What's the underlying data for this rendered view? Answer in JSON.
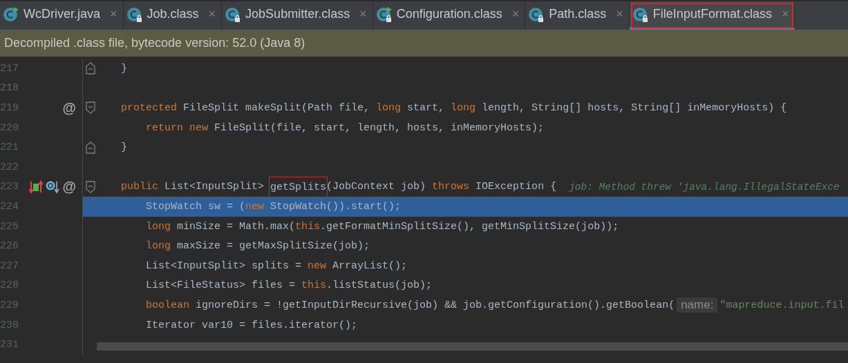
{
  "tabs": [
    {
      "label": "WcDriver.java",
      "kind": "runnable",
      "selected": false,
      "highlighted": false,
      "close": "×"
    },
    {
      "label": "Job.class",
      "kind": "locked",
      "selected": false,
      "highlighted": false,
      "close": "×"
    },
    {
      "label": "JobSubmitter.class",
      "kind": "locked",
      "selected": false,
      "highlighted": false,
      "close": "×"
    },
    {
      "label": "Configuration.class",
      "kind": "runnable-locked",
      "selected": false,
      "highlighted": false,
      "close": "×"
    },
    {
      "label": "Path.class",
      "kind": "locked",
      "selected": false,
      "highlighted": false,
      "close": "×"
    },
    {
      "label": "FileInputFormat.class",
      "kind": "locked",
      "selected": true,
      "highlighted": true,
      "close": "×"
    }
  ],
  "banner": "Decompiled .class file, bytecode version: 52.0 (Java 8)",
  "lines": [
    {
      "number": "217",
      "kind": "fold-end",
      "selected": false,
      "segments": [
        {
          "kind": "text",
          "text": "}"
        }
      ]
    },
    {
      "number": "218",
      "selected": false
    },
    {
      "number": "219",
      "kind": "fold-start",
      "selected": false,
      "marks": [
        {
          "kind": "text",
          "text": "@"
        }
      ],
      "segments": [
        {
          "kind": "keyword",
          "text": "protected"
        },
        {
          "kind": "text",
          "text": " FileSplit makeSplit(Path file, "
        },
        {
          "kind": "keyword",
          "text": "long"
        },
        {
          "kind": "text",
          "text": " start, "
        },
        {
          "kind": "keyword",
          "text": "long"
        },
        {
          "kind": "text",
          "text": " length, String[] hosts, String[] inMemoryHosts) {"
        }
      ],
      "children": [
        {
          "number": "220",
          "selected": false,
          "segments": [
            {
              "kind": "keyword",
              "text": "return new"
            },
            {
              "kind": "text",
              "text": " FileSplit(file, start, length, hosts, inMemoryHosts);"
            }
          ]
        }
      ]
    },
    {
      "number": "221",
      "kind": "fold-end",
      "selected": false,
      "segments": [
        {
          "kind": "text",
          "text": "}"
        }
      ]
    },
    {
      "number": "222",
      "selected": false
    },
    {
      "number": "223",
      "kind": "fold-start",
      "selected": false,
      "marks": [
        {
          "kind": "overriding"
        },
        {
          "kind": "overridden"
        },
        {
          "kind": "text",
          "text": "@"
        }
      ],
      "segments": [
        {
          "kind": "keyword",
          "text": "public"
        },
        {
          "kind": "text",
          "text": " List<InputSplit> "
        },
        {
          "kind": "highlighted",
          "text": "getSplits"
        },
        {
          "kind": "text",
          "text": "(JobContext job) "
        },
        {
          "kind": "keyword",
          "text": "throws"
        },
        {
          "kind": "text",
          "text": " IOException {"
        },
        {
          "kind": "hint",
          "text": "job: Method threw 'java.lang.IllegalStateExce"
        }
      ],
      "children": [
        {
          "number": "224",
          "selected": true,
          "segments": [
            {
              "kind": "text",
              "text": "StopWatch sw = ("
            },
            {
              "kind": "keyword",
              "text": "new"
            },
            {
              "kind": "text",
              "text": " StopWatch()).start();"
            }
          ]
        },
        {
          "number": "225",
          "selected": false,
          "segments": [
            {
              "kind": "keyword",
              "text": "long"
            },
            {
              "kind": "text",
              "text": " minSize = Math.max("
            },
            {
              "kind": "keyword",
              "text": "this"
            },
            {
              "kind": "text",
              "text": ".getFormatMinSplitSize(), getMinSplitSize(job));"
            }
          ]
        },
        {
          "number": "226",
          "selected": false,
          "segments": [
            {
              "kind": "keyword",
              "text": "long"
            },
            {
              "kind": "text",
              "text": " maxSize = getMaxSplitSize(job);"
            }
          ]
        },
        {
          "number": "227",
          "selected": false,
          "segments": [
            {
              "kind": "text",
              "text": "List<InputSplit> splits = "
            },
            {
              "kind": "keyword",
              "text": "new"
            },
            {
              "kind": "text",
              "text": " ArrayList();"
            }
          ]
        },
        {
          "number": "228",
          "selected": false,
          "segments": [
            {
              "kind": "text",
              "text": "List<FileStatus> files = "
            },
            {
              "kind": "keyword",
              "text": "this"
            },
            {
              "kind": "text",
              "text": ".listStatus(job);"
            }
          ]
        },
        {
          "number": "229",
          "selected": false,
          "segments": [
            {
              "kind": "keyword",
              "text": "boolean"
            },
            {
              "kind": "text",
              "text": " ignoreDirs = !getInputDirRecursive(job) && job.getConfiguration().getBoolean("
            },
            {
              "kind": "inlay",
              "text": "name:"
            },
            {
              "kind": "string",
              "text": "\"mapreduce.input.fil"
            }
          ]
        },
        {
          "number": "230",
          "selected": false,
          "segments": [
            {
              "kind": "text",
              "text": "Iterator var10 = files.iterator();"
            }
          ]
        }
      ]
    },
    {
      "number": "231",
      "selected": false
    }
  ]
}
